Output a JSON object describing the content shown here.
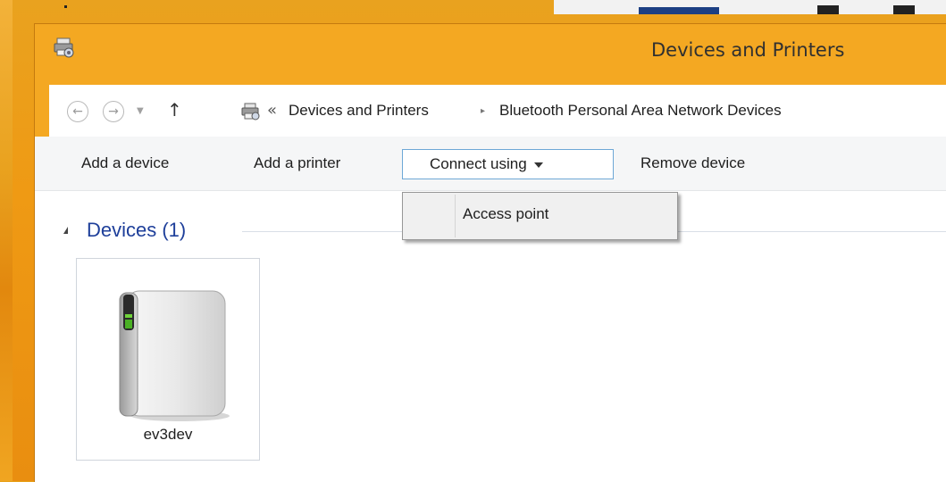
{
  "window": {
    "title": "Devices and Printers"
  },
  "address": {
    "overflow_chevron": "«",
    "crumbs": [
      "Devices and Printers",
      "Bluetooth Personal Area Network Devices"
    ],
    "separator": "▸"
  },
  "commands": {
    "add_device": "Add a device",
    "add_printer": "Add a printer",
    "connect_using": "Connect using",
    "remove_device": "Remove device"
  },
  "menu": {
    "items": [
      "Access point"
    ]
  },
  "group": {
    "label": "Devices (1)"
  },
  "devices": [
    {
      "name": "ev3dev"
    }
  ],
  "colors": {
    "title_bar": "#f4a822",
    "group_header": "#1e3f9a",
    "active_button_border": "#6ea8d6"
  }
}
